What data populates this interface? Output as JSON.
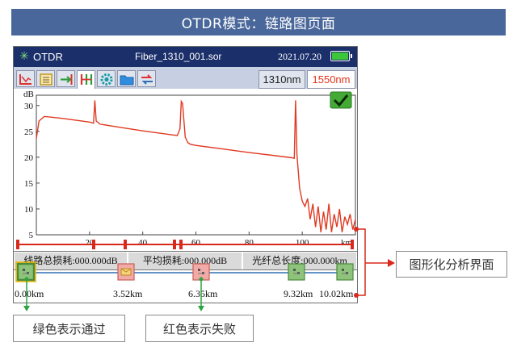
{
  "banner": {
    "title": "OTDR模式：链路图页面"
  },
  "titlebar": {
    "app": "OTDR",
    "file": "Fiber_1310_001.sor",
    "date": "2021.07.20"
  },
  "tabs": [
    "trace-tab",
    "table-tab",
    "link-tab",
    "map-tab",
    "settings-tab",
    "file-tab",
    "compare-tab"
  ],
  "wavelengths": {
    "w1": "1310nm",
    "w2": "1550nm"
  },
  "chart_data": {
    "type": "line",
    "ylabel": "dB",
    "xlabel": "km",
    "xlim": [
      0,
      120
    ],
    "ylim": [
      5,
      32
    ],
    "x_ticks": [
      20,
      40,
      60,
      80,
      100
    ],
    "y_ticks": [
      5,
      10,
      15,
      20,
      25,
      30
    ],
    "grid": false,
    "pass_indicator": "checkmark",
    "series": [
      {
        "color": "#e03a22",
        "x": [
          0,
          1,
          3,
          10,
          20,
          21.5,
          22,
          22.5,
          24,
          30,
          40,
          50,
          53,
          54,
          54.5,
          55,
          56,
          57,
          58,
          60,
          70,
          80,
          90,
          96,
          97,
          97.5,
          98,
          99,
          100,
          101,
          102,
          103,
          104,
          105,
          106,
          107,
          108,
          109,
          110,
          111,
          112,
          113,
          114,
          115,
          116,
          117,
          118,
          119,
          120
        ],
        "y": [
          23.6,
          27,
          27.9,
          27.5,
          26.8,
          26.6,
          31,
          27,
          26.4,
          25.9,
          25.1,
          24.4,
          24.2,
          25.5,
          30.8,
          30.4,
          23.9,
          22.8,
          22.5,
          22.3,
          21.6,
          20.9,
          20.3,
          19.9,
          19.8,
          31,
          20.5,
          14,
          11.5,
          10.5,
          12,
          8,
          11,
          6.5,
          10.5,
          5.5,
          9.5,
          6,
          11,
          5.5,
          9,
          6.5,
          10,
          5.5,
          8.5,
          7,
          9,
          6,
          8
        ]
      }
    ]
  },
  "stats": {
    "total_loss": "线路总损耗:000.000dB",
    "avg_loss": "平均损耗:000.000dB",
    "total_length": "光纤总长度:000.000km"
  },
  "events": [
    {
      "label": "0.00km",
      "status": "pass"
    },
    {
      "label": "3.52km",
      "status": "fail"
    },
    {
      "label": "6.35km",
      "status": "fail"
    },
    {
      "label": "9.32km",
      "status": "pass"
    },
    {
      "label": "10.02km",
      "status": "pass"
    }
  ],
  "colors": {
    "pass": "#8dc37a",
    "fail": "#f2aaa6",
    "line": "#2f6fb4",
    "bar": "#d8291c",
    "arrow": "#2ea343"
  },
  "callouts": {
    "graph_interface": "图形化分析界面",
    "green_pass": "绿色表示通过",
    "red_fail": "红色表示失败"
  }
}
